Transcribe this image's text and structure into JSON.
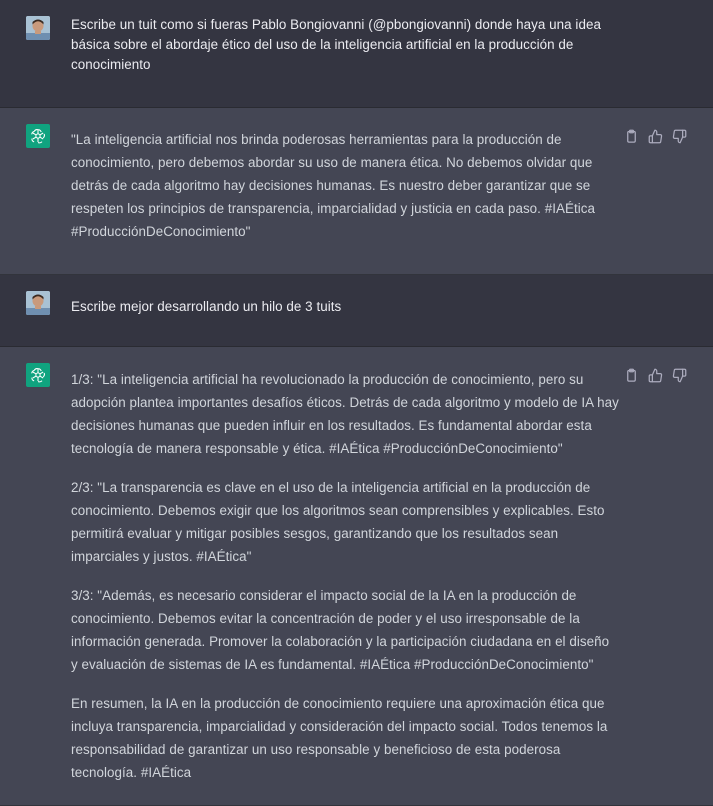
{
  "conversation": [
    {
      "role": "user",
      "paragraphs": [
        "Escribe un tuit como si fueras Pablo Bongiovanni (@pbongiovanni) donde haya una idea básica sobre el abordaje ético del uso de la inteligencia artificial en la producción de conocimiento"
      ]
    },
    {
      "role": "assistant",
      "paragraphs": [
        "\"La inteligencia artificial nos brinda poderosas herramientas para la producción de conocimiento, pero debemos abordar su uso de manera ética. No debemos olvidar que detrás de cada algoritmo hay decisiones humanas. Es nuestro deber garantizar que se respeten los principios de transparencia, imparcialidad y justicia en cada paso. #IAÉtica #ProducciónDeConocimiento\""
      ]
    },
    {
      "role": "user",
      "paragraphs": [
        "Escribe mejor desarrollando un hilo de 3 tuits"
      ]
    },
    {
      "role": "assistant",
      "paragraphs": [
        "1/3: \"La inteligencia artificial ha revolucionado la producción de conocimiento, pero su adopción plantea importantes desafíos éticos. Detrás de cada algoritmo y modelo de IA hay decisiones humanas que pueden influir en los resultados. Es fundamental abordar esta tecnología de manera responsable y ética. #IAÉtica #ProducciónDeConocimiento\"",
        "2/3: \"La transparencia es clave en el uso de la inteligencia artificial en la producción de conocimiento. Debemos exigir que los algoritmos sean comprensibles y explicables. Esto permitirá evaluar y mitigar posibles sesgos, garantizando que los resultados sean imparciales y justos. #IAÉtica\"",
        "3/3: \"Además, es necesario considerar el impacto social de la IA en la producción de conocimiento. Debemos evitar la concentración de poder y el uso irresponsable de la información generada. Promover la colaboración y la participación ciudadana en el diseño y evaluación de sistemas de IA es fundamental. #IAÉtica #ProducciónDeConocimiento\"",
        "En resumen, la IA en la producción de conocimiento requiere una aproximación ética que incluya transparencia, imparcialidad y consideración del impacto social. Todos tenemos la responsabilidad de garantizar un uso responsable y beneficioso de esta poderosa tecnología. #IAÉtica"
      ]
    }
  ],
  "icons": {
    "copy": "clipboard-icon",
    "like": "thumbs-up-icon",
    "dislike": "thumbs-down-icon",
    "assistant_avatar": "openai-logo-icon",
    "user_avatar": "user-photo-avatar"
  },
  "colors": {
    "user_bg": "#343541",
    "assistant_bg": "#444654",
    "assistant_avatar_bg": "#10a37f",
    "text": "#d1d5db"
  }
}
